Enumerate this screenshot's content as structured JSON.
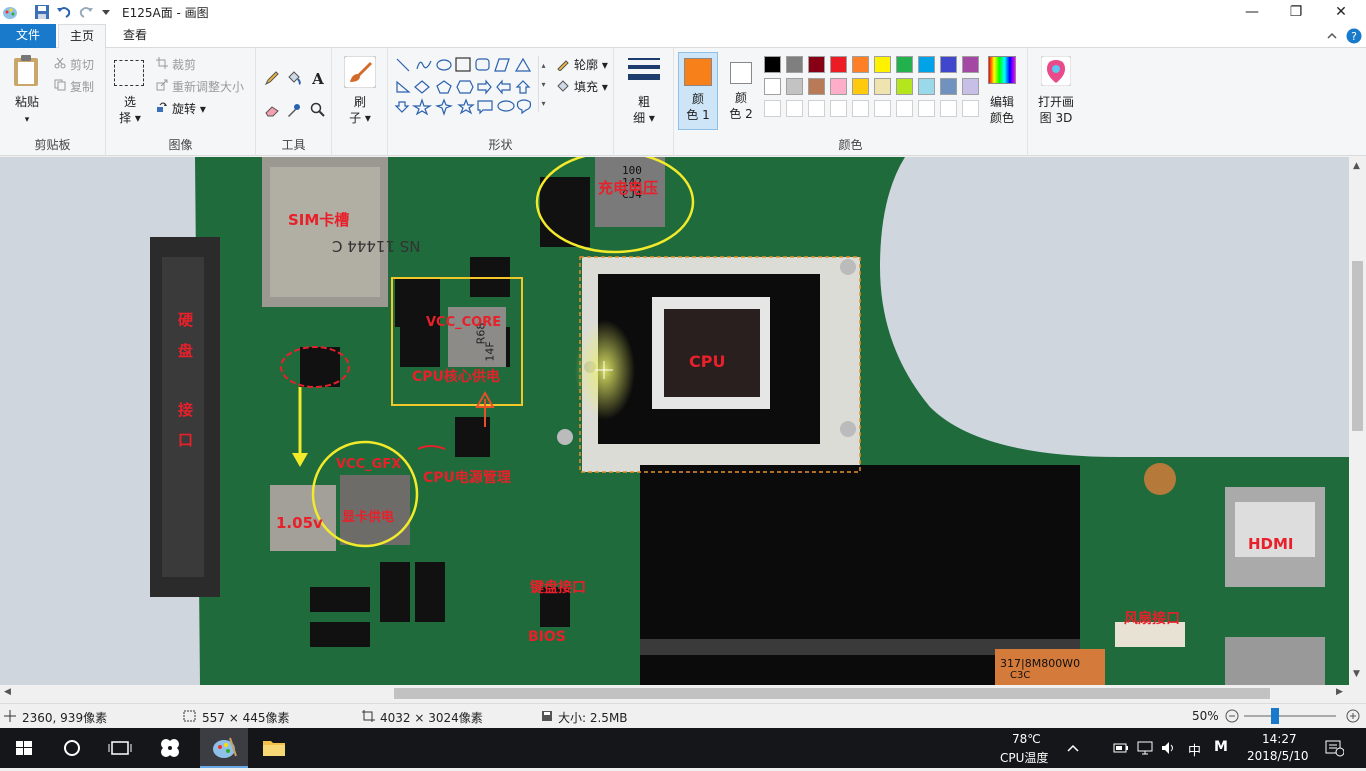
{
  "titlebar": {
    "title": "E125A面 - 画图",
    "min": "—",
    "max": "❐",
    "close": "✕"
  },
  "tabs": {
    "file": "文件",
    "home": "主页",
    "view": "查看"
  },
  "ribbon": {
    "clipboard": {
      "paste": "粘贴",
      "cut": "剪切",
      "copy": "复制",
      "group": "剪贴板"
    },
    "image": {
      "select": "选",
      "select2": "择",
      "crop": "裁剪",
      "resize": "重新调整大小",
      "rotate": "旋转",
      "group": "图像"
    },
    "tools": {
      "group": "工具"
    },
    "brush": {
      "l1": "刷",
      "l2": "子"
    },
    "shapes": {
      "outline": "轮廓",
      "fill": "填充",
      "group": "形状"
    },
    "size": {
      "l1": "粗",
      "l2": "细"
    },
    "color1": {
      "l1": "颜",
      "l2": "色 1",
      "value": "#f7801b"
    },
    "color2": {
      "l1": "颜",
      "l2": "色 2",
      "value": "#ffffff"
    },
    "colors": {
      "group": "颜色",
      "edit1": "编辑",
      "edit2": "颜色"
    },
    "paint3d": {
      "l1": "打开画",
      "l2": "图 3D"
    },
    "palette": [
      "#000000",
      "#7f7f7f",
      "#880015",
      "#ed1c24",
      "#ff7f27",
      "#fff200",
      "#22b14c",
      "#00a2e8",
      "#3f48cc",
      "#a349a4",
      "#ffffff",
      "#c3c3c3",
      "#b97a57",
      "#ffaec9",
      "#ffc90e",
      "#efe4b0",
      "#b5e61d",
      "#99d9ea",
      "#7092be",
      "#c8bfe7"
    ]
  },
  "canvas_labels": {
    "sim": "SIM卡槽",
    "charge": "充电电压",
    "vcc_core": "VCC_CORE",
    "cpu_core_power": "CPU核心供电",
    "cpu": "CPU",
    "hdd1": "硬",
    "hdd2": "盘",
    "hdd3": "接",
    "hdd4": "口",
    "vcc_gfx": "VCC_GFX",
    "cpu_power_mgmt": "CPU电源管理",
    "v105": "1.05v",
    "gpu_power": "显卡供电",
    "hdmi": "HDMI",
    "kbd": "键盘接口",
    "bios": "BIOS",
    "fan": "风扇接口",
    "chip_text1": "100",
    "chip_text2": "142",
    "chip_text3": "CJ4",
    "slot_text": "NS 11444 C",
    "inductor1": "R68",
    "inductor2": "14F",
    "sticker": "317|8M800W0",
    "sticker2": "C3C"
  },
  "status": {
    "cursor": "2360, 939像素",
    "selection": "557 × 445像素",
    "image_size": "4032 × 3024像素",
    "file_size": "大小: 2.5MB",
    "zoom": "50%",
    "zoom_level": 0.5
  },
  "taskbar": {
    "temp": "78℃",
    "temp_label": "CPU温度",
    "ime": "中",
    "ime2": "M",
    "time": "14:27",
    "date": "2018/5/10"
  }
}
